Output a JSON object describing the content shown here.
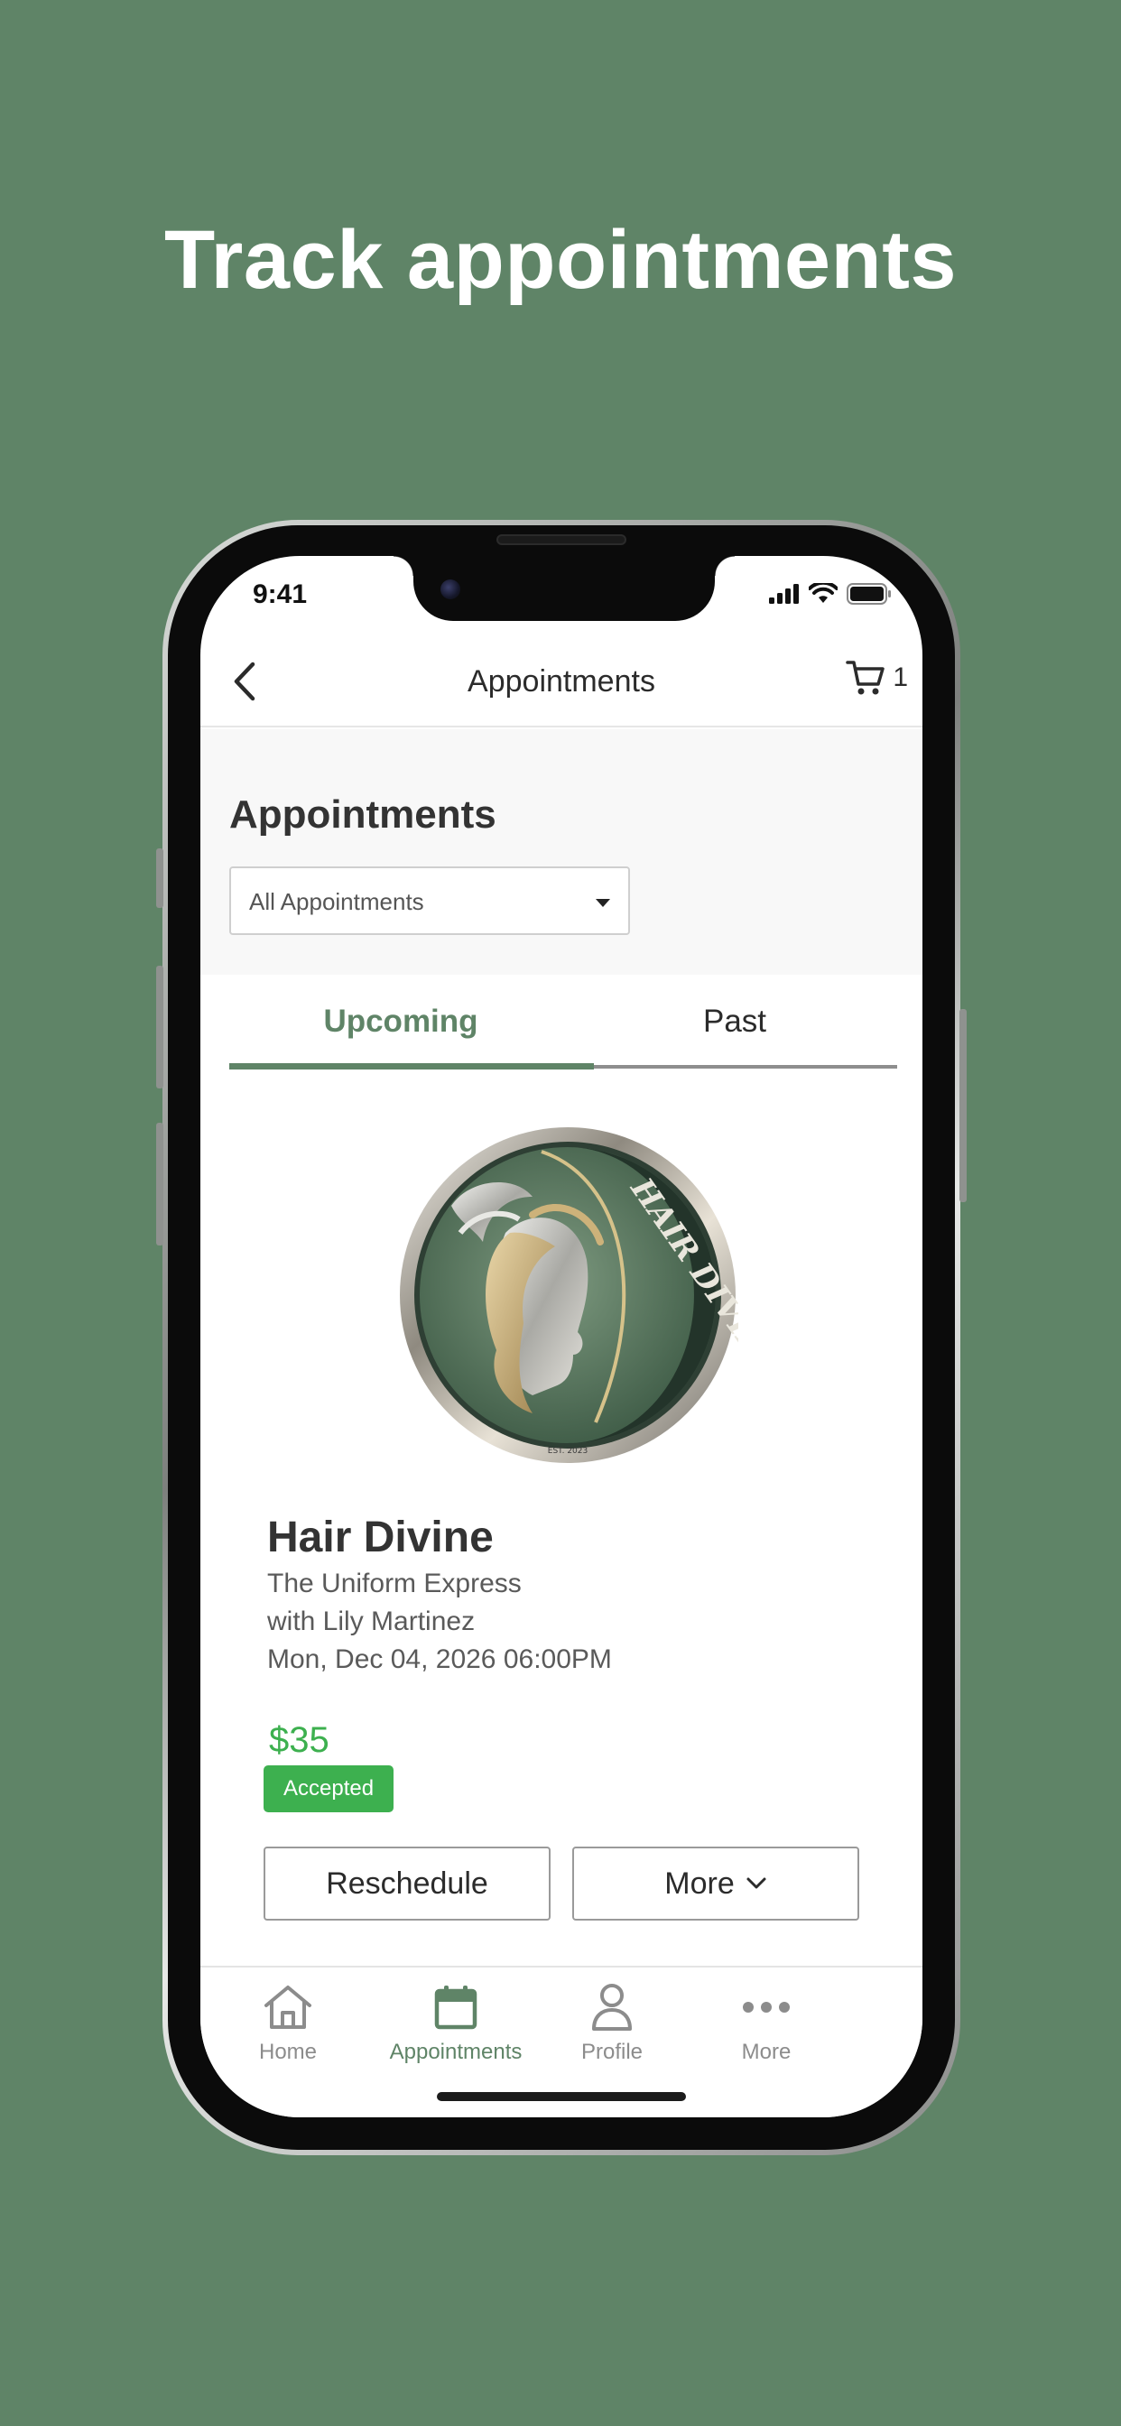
{
  "headline": "Track appointments",
  "status_bar": {
    "time": "9:41"
  },
  "nav": {
    "title": "Appointments",
    "cart_count": "1"
  },
  "page": {
    "section_title": "Appointments",
    "filter": {
      "selected": "All Appointments"
    }
  },
  "tabs": [
    {
      "label": "Upcoming",
      "active": true
    },
    {
      "label": "Past",
      "active": false
    }
  ],
  "appointment": {
    "logo_text": "HAIR DIVINE",
    "logo_est": "EST. 2023",
    "business_name": "Hair Divine",
    "service": "The Uniform Express",
    "stylist": "with Lily Martinez",
    "datetime": "Mon, Dec 04, 2026 06:00PM",
    "price": "$35",
    "status": "Accepted",
    "actions": {
      "reschedule": "Reschedule",
      "more": "More"
    }
  },
  "tabbar": [
    {
      "label": "Home",
      "icon": "home-icon",
      "active": false
    },
    {
      "label": "Appointments",
      "icon": "calendar-icon",
      "active": true
    },
    {
      "label": "Profile",
      "icon": "person-icon",
      "active": false
    },
    {
      "label": "More",
      "icon": "more-dots-icon",
      "active": false
    }
  ],
  "colors": {
    "background": "#5f8467",
    "accent": "#5f8467",
    "price_green": "#3db04f",
    "badge_green": "#3db04f"
  }
}
